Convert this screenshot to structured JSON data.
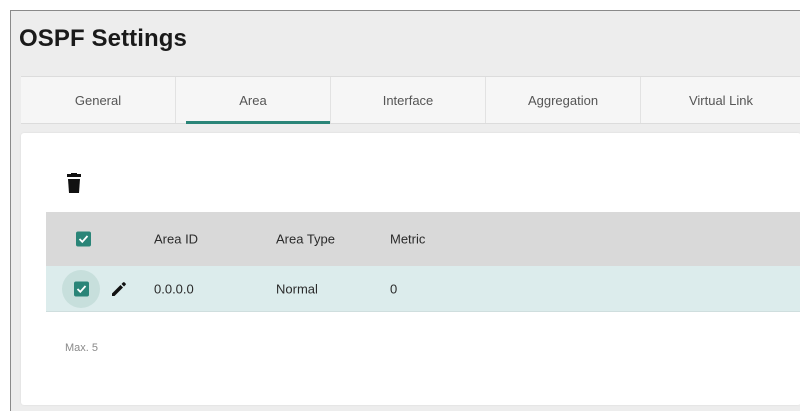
{
  "page": {
    "title": "OSPF Settings"
  },
  "tabs": [
    {
      "label": "General",
      "active": false
    },
    {
      "label": "Area",
      "active": true
    },
    {
      "label": "Interface",
      "active": false
    },
    {
      "label": "Aggregation",
      "active": false
    },
    {
      "label": "Virtual Link",
      "active": false
    }
  ],
  "toolbar": {
    "delete_icon": "trash-icon"
  },
  "table": {
    "columns": [
      "Area ID",
      "Area Type",
      "Metric"
    ],
    "rows": [
      {
        "checked": true,
        "area_id": "0.0.0.0",
        "area_type": "Normal",
        "metric": "0"
      }
    ],
    "header_checked": true
  },
  "footer": {
    "max_note": "Max. 5"
  },
  "colors": {
    "accent": "#2a8578",
    "row_selected": "#dcecec",
    "header_bg": "#d9d9d9"
  }
}
